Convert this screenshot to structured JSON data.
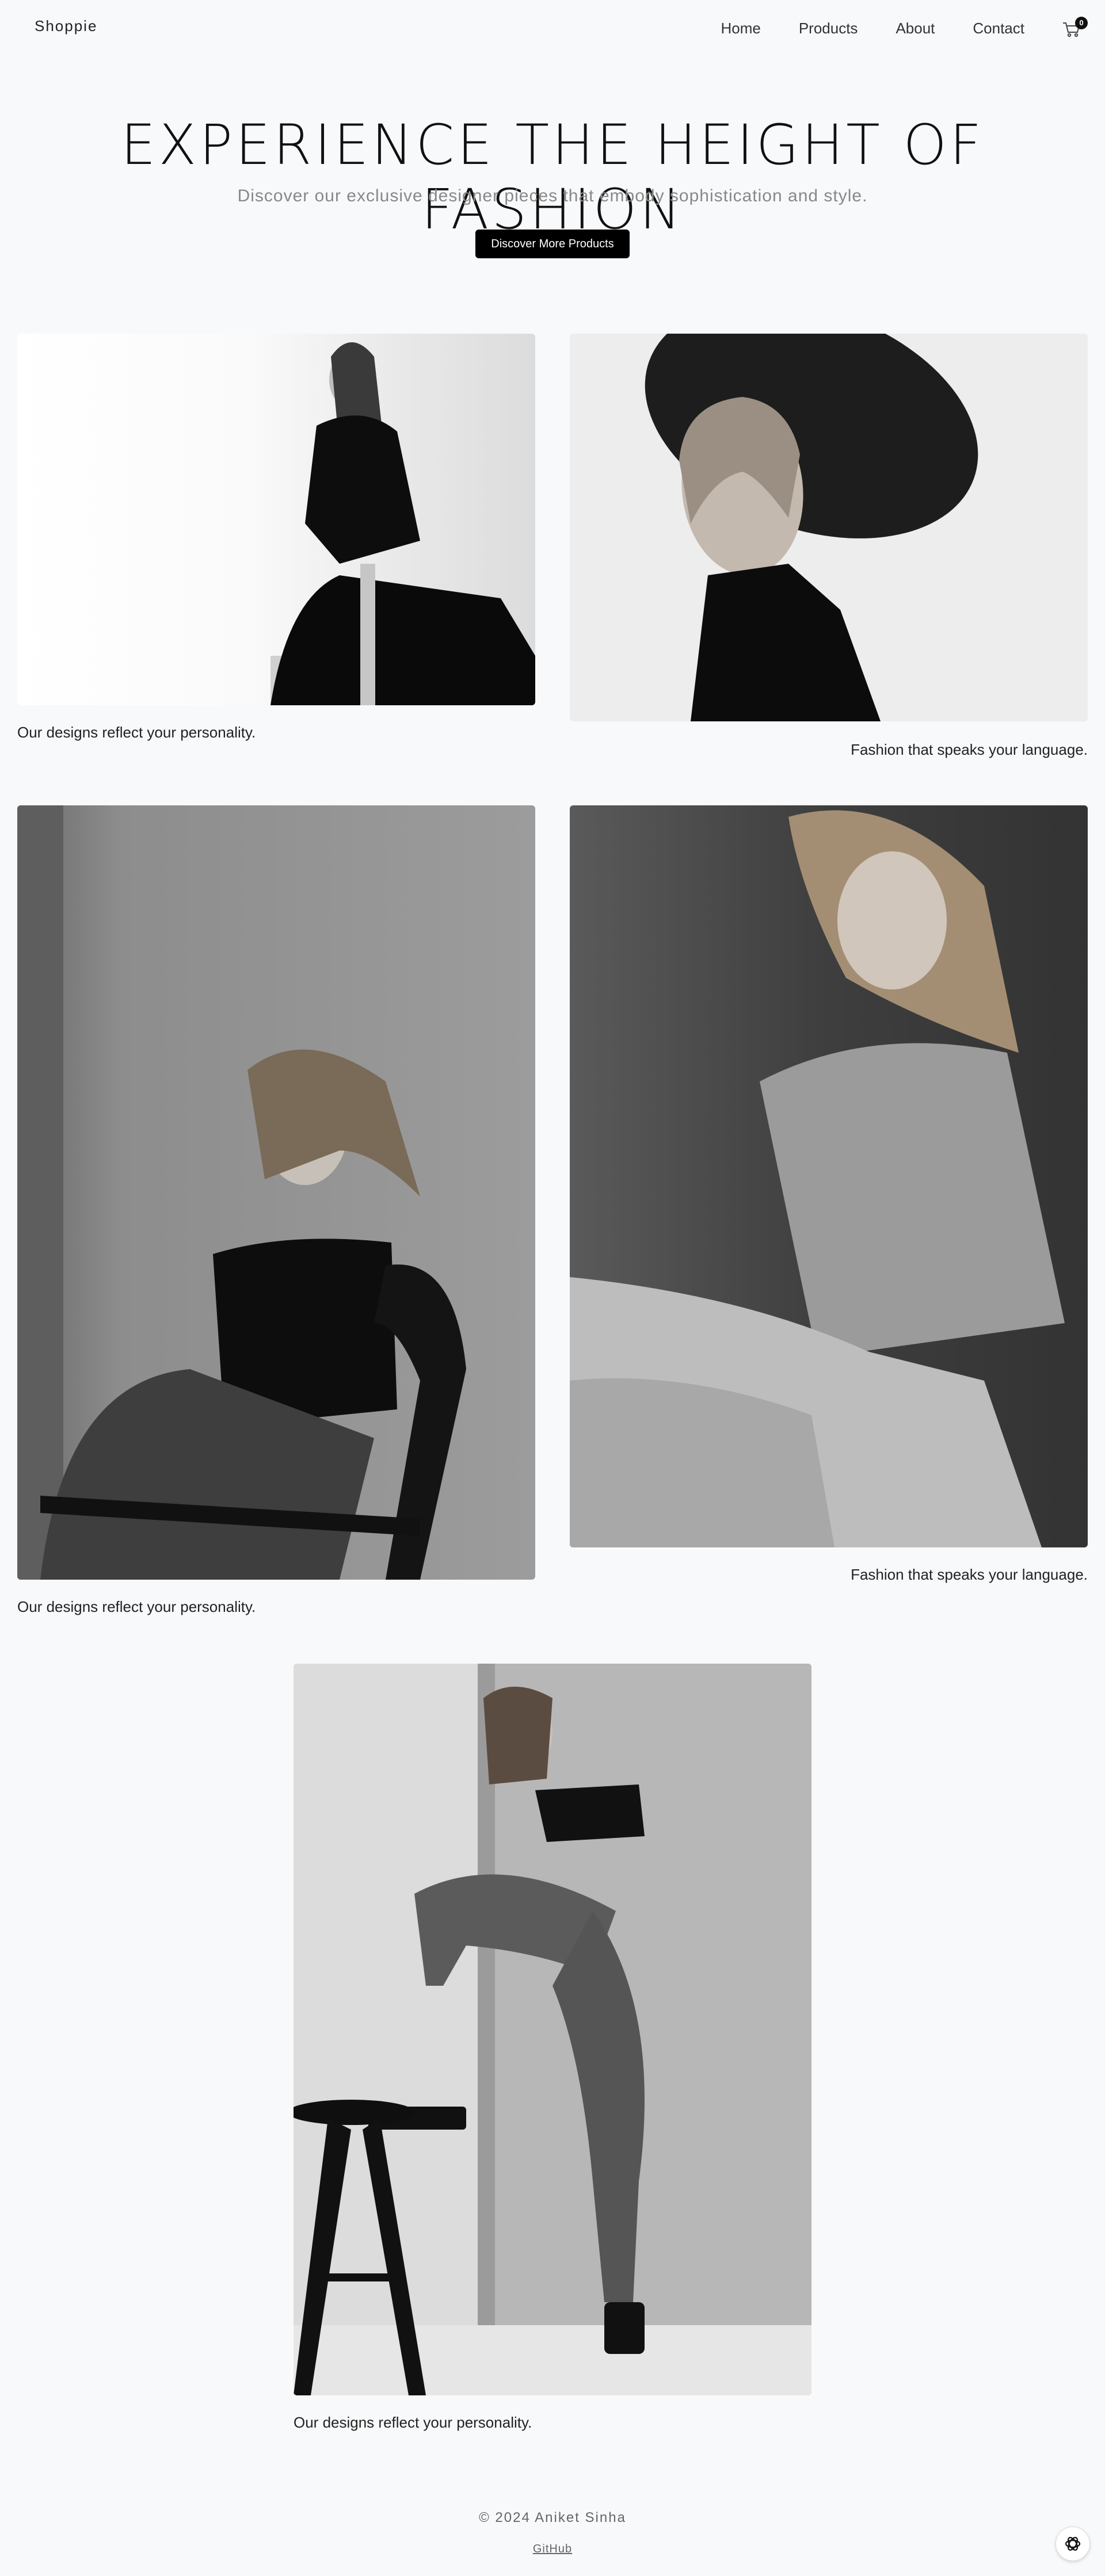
{
  "header": {
    "brand": "Shoppie",
    "nav": [
      "Home",
      "Products",
      "About",
      "Contact"
    ],
    "cart_count": "0",
    "cart_icon": "shopping-cart-icon"
  },
  "hero": {
    "title": "EXPERIENCE THE HEIGHT OF FASHION",
    "subtitle": "Discover our exclusive designer pieces that embody sophistication and style.",
    "button_label": "Discover More Products"
  },
  "gallery": [
    {
      "caption": "Our designs reflect your personality."
    },
    {
      "caption": "Fashion that speaks your language."
    },
    {
      "caption": "Our designs reflect your personality."
    },
    {
      "caption": "Fashion that speaks your language."
    },
    {
      "caption": "Our designs reflect your personality."
    }
  ],
  "footer": {
    "copyright": "© 2024 Aniket Sinha",
    "link": "GitHub"
  },
  "chat_icon": "openai-logo-icon",
  "colors": {
    "background": "#f8f9fb",
    "button": "#000000",
    "text": "#111111"
  }
}
